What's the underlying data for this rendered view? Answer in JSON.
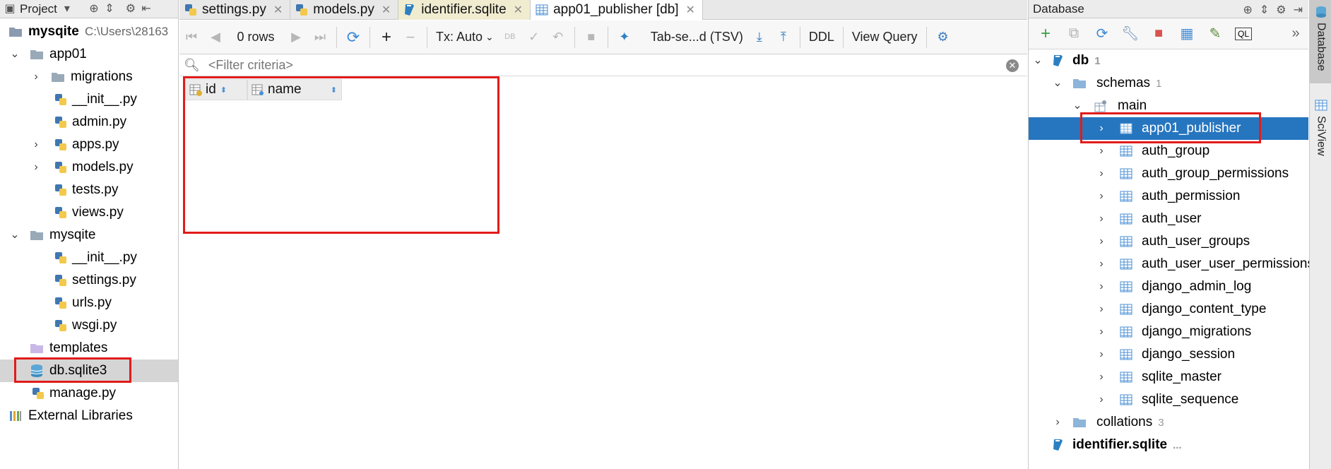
{
  "project": {
    "header_label": "Project",
    "root_label": "mysqite",
    "root_path": "C:\\Users\\28163",
    "items": [
      {
        "label": "app01"
      },
      {
        "label": "migrations"
      },
      {
        "label": "__init__.py"
      },
      {
        "label": "admin.py"
      },
      {
        "label": "apps.py"
      },
      {
        "label": "models.py"
      },
      {
        "label": "tests.py"
      },
      {
        "label": "views.py"
      },
      {
        "label": "mysqite"
      },
      {
        "label": "__init__.py"
      },
      {
        "label": "settings.py"
      },
      {
        "label": "urls.py"
      },
      {
        "label": "wsgi.py"
      },
      {
        "label": "templates"
      },
      {
        "label": "db.sqlite3"
      },
      {
        "label": "manage.py"
      },
      {
        "label": "External Libraries"
      }
    ]
  },
  "tabs": [
    {
      "label": "settings.py"
    },
    {
      "label": "models.py"
    },
    {
      "label": "identifier.sqlite"
    },
    {
      "label": "app01_publisher [db]"
    }
  ],
  "toolbar": {
    "rows_label": "0 rows",
    "tx_label": "Tx: Auto",
    "tx_small": "DB",
    "format_label": "Tab-se...d (TSV)",
    "ddl_label": "DDL",
    "view_query_label": "View Query"
  },
  "filter": {
    "placeholder": "<Filter criteria>"
  },
  "grid": {
    "columns": [
      {
        "label": "id"
      },
      {
        "label": "name"
      }
    ]
  },
  "database": {
    "header_label": "Database",
    "nodes": {
      "db": {
        "label": "db",
        "count": "1"
      },
      "schemas": {
        "label": "schemas",
        "count": "1"
      },
      "main": {
        "label": "main"
      },
      "collations": {
        "label": "collations",
        "count": "3"
      },
      "identifier": {
        "label": "identifier.sqlite",
        "suffix": "..."
      }
    },
    "tables": [
      {
        "label": "app01_publisher"
      },
      {
        "label": "auth_group"
      },
      {
        "label": "auth_group_permissions"
      },
      {
        "label": "auth_permission"
      },
      {
        "label": "auth_user"
      },
      {
        "label": "auth_user_groups"
      },
      {
        "label": "auth_user_user_permissions"
      },
      {
        "label": "django_admin_log"
      },
      {
        "label": "django_content_type"
      },
      {
        "label": "django_migrations"
      },
      {
        "label": "django_session"
      },
      {
        "label": "sqlite_master"
      },
      {
        "label": "sqlite_sequence"
      }
    ]
  },
  "side_tabs": {
    "database": "Database",
    "sciview": "SciView"
  },
  "colors": {
    "selection": "#2675bf",
    "highlight_box": "#e21b1b",
    "folder": "#8db4d9",
    "py_blue": "#3f77b1",
    "py_yellow": "#f2c94c"
  }
}
